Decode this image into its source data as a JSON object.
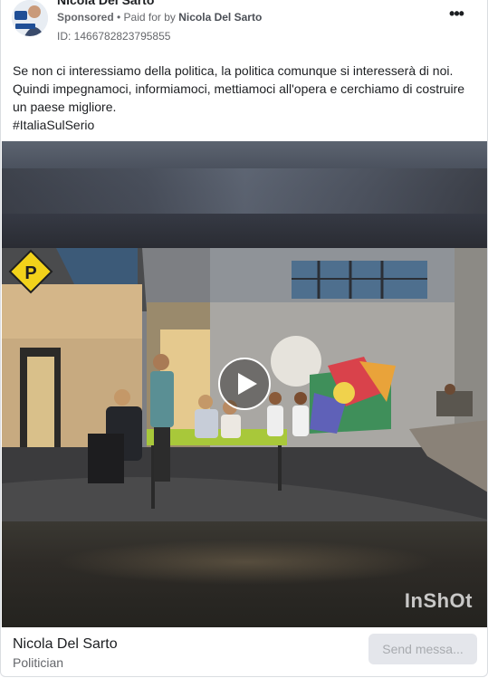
{
  "ad": {
    "page_name": "Nicola Del Sarto",
    "sponsored_label": "Sponsored",
    "separator": " • ",
    "paid_for_prefix": "Paid for by ",
    "paid_for_name": "Nicola Del Sarto",
    "library_id": "ID: 1466782823795855",
    "more_label": "•••",
    "text_lines": [
      "Se non ci interessiamo della politica, la politica comunque si interesserà di noi.",
      "Quindi impegnamoci, informiamoci, mettiamoci all'opera e cerchiamo di costruire",
      "un paese migliore.",
      "#ItaliaSulSerio"
    ],
    "video": {
      "watermark": "InShOt",
      "play_icon": "play-icon"
    },
    "footer": {
      "name": "Nicola Del Sarto",
      "category": "Politician",
      "cta_label": "Send messa..."
    }
  },
  "colors": {
    "text_primary": "#1c1e21",
    "text_secondary": "#65676b",
    "button_disabled_bg": "#e4e6eb",
    "button_disabled_text": "#a8abaf",
    "border": "#dadde1"
  }
}
